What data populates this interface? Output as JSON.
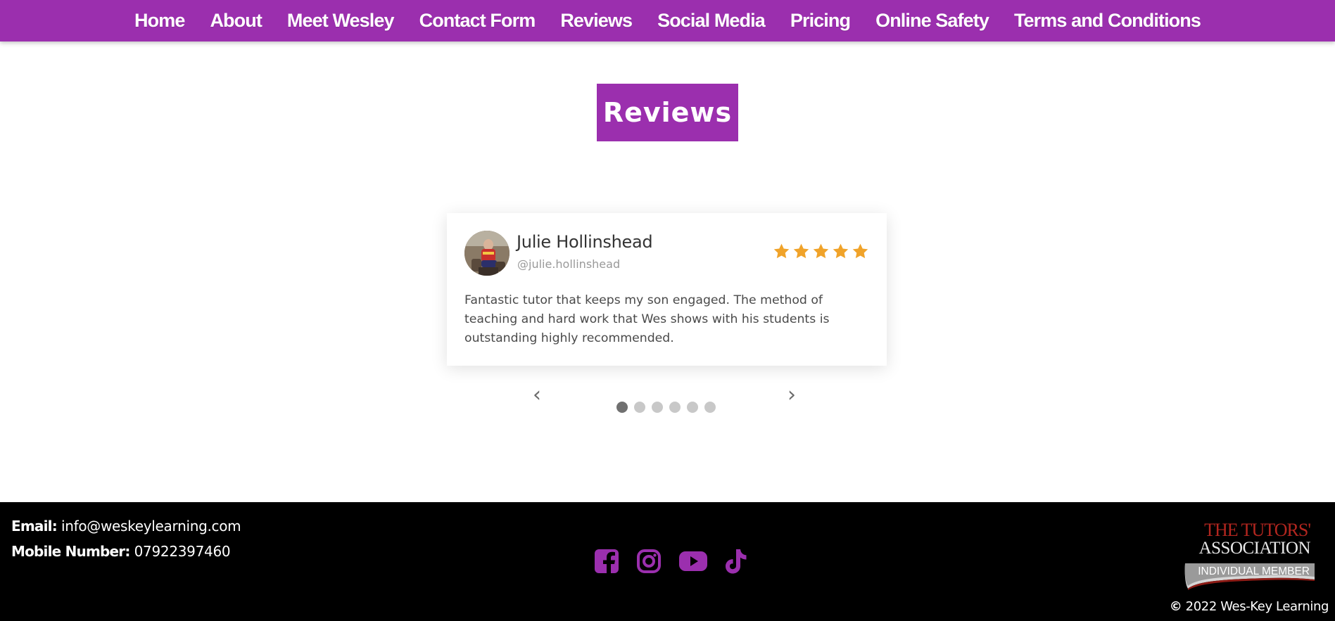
{
  "nav": {
    "items": [
      {
        "label": "Home"
      },
      {
        "label": "About"
      },
      {
        "label": "Meet Wesley"
      },
      {
        "label": "Contact Form"
      },
      {
        "label": "Reviews"
      },
      {
        "label": "Social Media"
      },
      {
        "label": "Pricing"
      },
      {
        "label": "Online Safety"
      },
      {
        "label": "Terms and Conditions"
      }
    ]
  },
  "page": {
    "title": "Reviews"
  },
  "review": {
    "name": "Julie Hollinshead",
    "handle": "@julie.hollinshead",
    "rating": 5,
    "rating_max": 5,
    "text": "Fantastic tutor that keeps my son engaged. The method of teaching and hard work that Wes shows with his students is outstanding highly recommended."
  },
  "carousel": {
    "prev_icon": "‹",
    "next_icon": "›",
    "slide_count": 6,
    "active_index": 0
  },
  "footer": {
    "email_label": "Email:",
    "email_value": "info@weskeylearning.com",
    "mobile_label": "Mobile Number:",
    "mobile_value": "07922397460",
    "social_icons": [
      "facebook-icon",
      "instagram-icon",
      "youtube-icon",
      "tiktok-icon"
    ],
    "badge": {
      "line1": "THE TUTORS'",
      "line2": "ASSOCIATION",
      "line3": "INDIVIDUAL MEMBER"
    },
    "copyright_icon": "©",
    "copyright_text": "2022 Wes-Key Learning"
  },
  "colors": {
    "brand_purple": "#9b2fae",
    "star_orange": "#f0a32a",
    "footer_bg": "#000000"
  }
}
